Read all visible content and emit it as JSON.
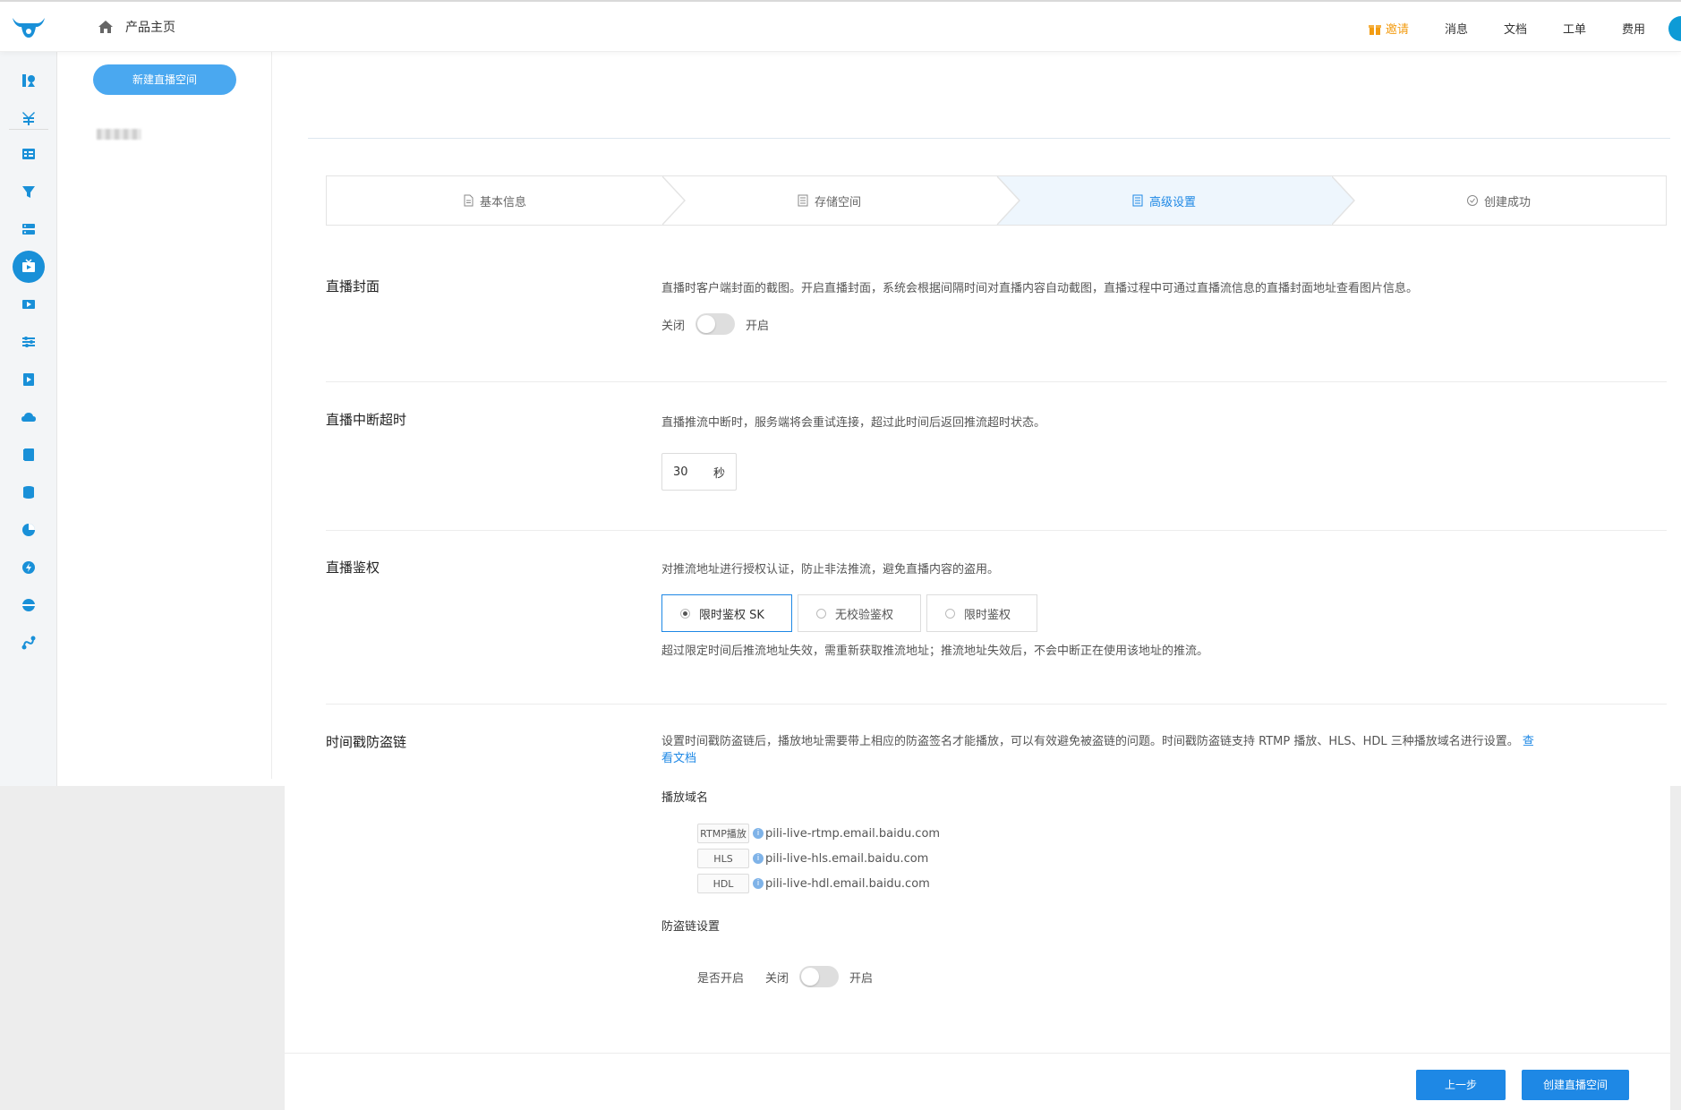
{
  "header": {
    "home_label": "产品主页",
    "nav": {
      "invite": "邀请",
      "messages": "消息",
      "docs": "文档",
      "tickets": "工单",
      "billing": "费用"
    },
    "accent": "#1990d8",
    "invite_color": "#f39c12"
  },
  "sidebar": {
    "new_space_button": "新建直播空间"
  },
  "steps": [
    {
      "label": "基本信息",
      "active": false
    },
    {
      "label": "存储空间",
      "active": false
    },
    {
      "label": "高级设置",
      "active": true
    },
    {
      "label": "创建成功",
      "active": false
    }
  ],
  "cover": {
    "title": "直播封面",
    "description": "直播时客户端封面的截图。开启直播封面，系统会根据间隔时间对直播内容自动截图，直播过程中可通过直播流信息的直播封面地址查看图片信息。",
    "off_label": "关闭",
    "on_label": "开启",
    "enabled": false
  },
  "timeout": {
    "title": "直播中断超时",
    "description": "直播推流中断时，服务端将会重试连接，超过此时间后返回推流超时状态。",
    "value": "30",
    "unit": "秒"
  },
  "auth": {
    "title": "直播鉴权",
    "description": "对推流地址进行授权认证，防止非法推流，避免直播内容的盗用。",
    "options": [
      {
        "label": "限时鉴权 SK",
        "selected": true
      },
      {
        "label": "无校验鉴权",
        "selected": false
      },
      {
        "label": "限时鉴权",
        "selected": false
      }
    ],
    "note": "超过限定时间后推流地址失效，需重新获取推流地址；推流地址失效后，不会中断正在使用该地址的推流。"
  },
  "antileech": {
    "title": "时间戳防盗链",
    "description": "设置时间戳防盗链后，播放地址需要带上相应的防盗签名才能播放，可以有效避免被盗链的问题。时间戳防盗链支持 RTMP 播放、HLS、HDL 三种播放域名进行设置。",
    "doc_link_1": "查",
    "doc_link_2": "看文档",
    "domains_title": "播放域名",
    "domains": [
      {
        "tag": "RTMP播放",
        "domain": "pili-live-rtmp.email.baidu.com"
      },
      {
        "tag": "HLS",
        "domain": "pili-live-hls.email.baidu.com"
      },
      {
        "tag": "HDL",
        "domain": "pili-live-hdl.email.baidu.com"
      }
    ],
    "settings_title": "防盗链设置",
    "enable_label": "是否开启",
    "off_label": "关闭",
    "on_label": "开启",
    "enabled": false
  },
  "footer": {
    "prev_button": "上一步",
    "create_button": "创建直播空间"
  }
}
